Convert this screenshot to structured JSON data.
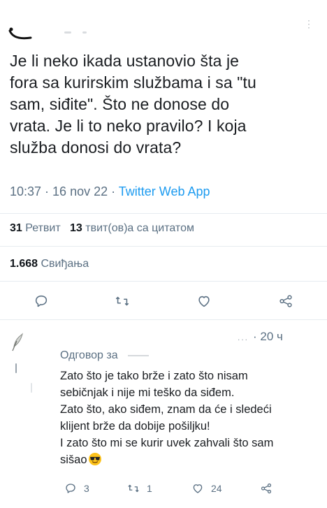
{
  "tweet": {
    "text": "Je li neko ikada ustanovio šta je\nfora sa kurirskim službama i sa \"tu\nsam, siđite\". Što ne donose do\nvrata. Je li to neko pravilo? I koja\nslužba donosi do vrata?",
    "time": "10:37",
    "date": "16 nov 22",
    "separator": " · ",
    "source": "Twitter Web App"
  },
  "stats": {
    "retweets_count": "31",
    "retweets_label": "Ретвит",
    "quotes_count": "13",
    "quotes_label": "твит(ов)а са цитатом",
    "likes_count": "1.668",
    "likes_label": "Свиђања"
  },
  "actions": {
    "icons": [
      "reply-icon",
      "retweet-icon",
      "like-icon",
      "share-icon"
    ]
  },
  "reply": {
    "time": "· 20 ч",
    "replying_to_label": "Одговор за",
    "text": "Zato što je tako brže i zato što nisam\nsebičnjak i nije mi teško da siđem.\nZato što, ako siđem, znam da će i sledeći\nklijent brže da dobije pošiljku!\nI zato što mi se kurir uvek zahvali što sam\nsišao",
    "emoji": "smiling-face-with-sunglasses",
    "reply_count": "3",
    "retweet_count": "1",
    "like_count": "24"
  },
  "colors": {
    "text": "#0f1419",
    "secondary": "#5b7083",
    "accent": "#1d9bf0",
    "divider": "#e6ecf0"
  }
}
